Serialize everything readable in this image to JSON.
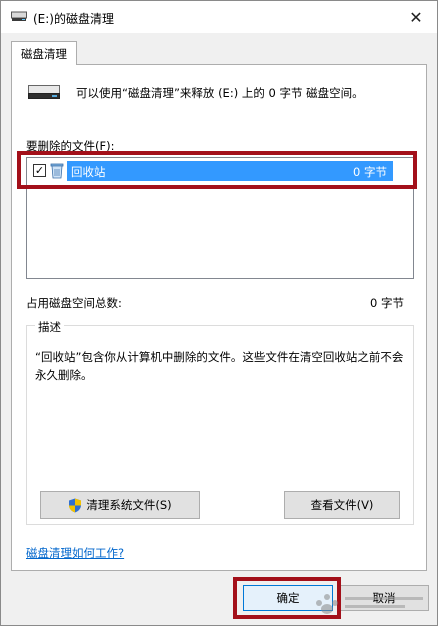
{
  "window": {
    "title": "(E:)的磁盘清理",
    "close_glyph": "✕"
  },
  "tab": {
    "label": "磁盘清理"
  },
  "summary": {
    "message": "可以使用“磁盘清理”来释放  (E:) 上的 0 字节 磁盘空间。"
  },
  "files": {
    "label": "要删除的文件(F):",
    "items": [
      {
        "name": "回收站",
        "size": "0 字节",
        "checked": true
      }
    ]
  },
  "total": {
    "label": "占用磁盘空间总数:",
    "value": "0 字节"
  },
  "description": {
    "title": "描述",
    "text": "“回收站”包含你从计算机中删除的文件。这些文件在清空回收站之前不会永久删除。"
  },
  "buttons": {
    "clean_system": "清理系统文件(S)",
    "view_files": "查看文件(V)",
    "ok": "确定",
    "cancel": "取消"
  },
  "help_link": "磁盘清理如何工作?",
  "colors": {
    "selection": "#3399ff",
    "annotation_red": "#a3101a",
    "link": "#0066cc"
  },
  "icons": {
    "title": "drive-icon",
    "drive": "drive-icon",
    "recycle_bin": "recycle-bin-icon",
    "shield": "uac-shield-icon",
    "watermark": "baidu-watermark-icon"
  }
}
